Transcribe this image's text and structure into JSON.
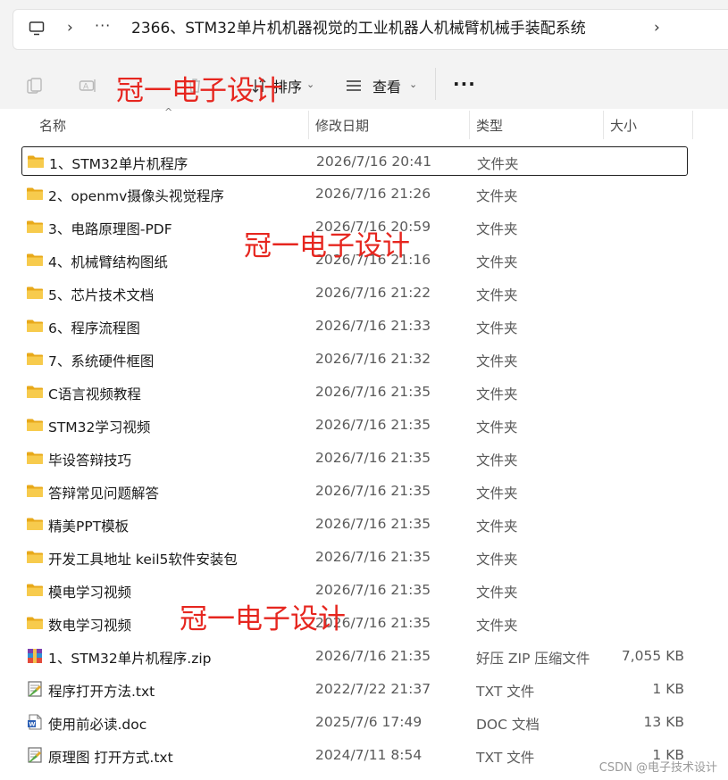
{
  "address": {
    "path": "2366、STM32单片机机器视觉的工业机器人机械臂机械手装配系统",
    "overflow": "···"
  },
  "commandbar": {
    "sort_label": "排序",
    "view_label": "查看",
    "more_label": "···"
  },
  "columns": {
    "name": "名称",
    "date": "修改日期",
    "type": "类型",
    "size": "大小"
  },
  "files": [
    {
      "name": "1、STM32单片机程序",
      "date": "2026/7/16 20:41",
      "type": "文件夹",
      "size": "",
      "icon": "folder-icon",
      "selected": true
    },
    {
      "name": "2、openmv摄像头视觉程序",
      "date": "2026/7/16 21:26",
      "type": "文件夹",
      "size": "",
      "icon": "folder-icon"
    },
    {
      "name": "3、电路原理图-PDF",
      "date": "2026/7/16 20:59",
      "type": "文件夹",
      "size": "",
      "icon": "folder-icon"
    },
    {
      "name": "4、机械臂结构图纸",
      "date": "2026/7/16 21:16",
      "type": "文件夹",
      "size": "",
      "icon": "folder-icon"
    },
    {
      "name": "5、芯片技术文档",
      "date": "2026/7/16 21:22",
      "type": "文件夹",
      "size": "",
      "icon": "folder-icon"
    },
    {
      "name": "6、程序流程图",
      "date": "2026/7/16 21:33",
      "type": "文件夹",
      "size": "",
      "icon": "folder-icon"
    },
    {
      "name": "7、系统硬件框图",
      "date": "2026/7/16 21:32",
      "type": "文件夹",
      "size": "",
      "icon": "folder-icon"
    },
    {
      "name": "C语言视频教程",
      "date": "2026/7/16 21:35",
      "type": "文件夹",
      "size": "",
      "icon": "folder-icon"
    },
    {
      "name": "STM32学习视频",
      "date": "2026/7/16 21:35",
      "type": "文件夹",
      "size": "",
      "icon": "folder-icon"
    },
    {
      "name": "毕设答辩技巧",
      "date": "2026/7/16 21:35",
      "type": "文件夹",
      "size": "",
      "icon": "folder-icon"
    },
    {
      "name": "答辩常见问题解答",
      "date": "2026/7/16 21:35",
      "type": "文件夹",
      "size": "",
      "icon": "folder-icon"
    },
    {
      "name": "精美PPT模板",
      "date": "2026/7/16 21:35",
      "type": "文件夹",
      "size": "",
      "icon": "folder-icon"
    },
    {
      "name": "开发工具地址 keil5软件安装包",
      "date": "2026/7/16 21:35",
      "type": "文件夹",
      "size": "",
      "icon": "folder-icon"
    },
    {
      "name": "模电学习视频",
      "date": "2026/7/16 21:35",
      "type": "文件夹",
      "size": "",
      "icon": "folder-icon"
    },
    {
      "name": "数电学习视频",
      "date": "2026/7/16 21:35",
      "type": "文件夹",
      "size": "",
      "icon": "folder-icon"
    },
    {
      "name": "1、STM32单片机程序.zip",
      "date": "2026/7/16 21:35",
      "type": "好压 ZIP 压缩文件",
      "size": "7,055 KB",
      "icon": "zip-archive-icon"
    },
    {
      "name": "程序打开方法.txt",
      "date": "2022/7/22 21:37",
      "type": "TXT 文件",
      "size": "1 KB",
      "icon": "text-file-icon"
    },
    {
      "name": "使用前必读.doc",
      "date": "2025/7/6 17:49",
      "type": "DOC 文档",
      "size": "13 KB",
      "icon": "word-doc-icon"
    },
    {
      "name": "原理图 打开方式.txt",
      "date": "2024/7/11 8:54",
      "type": "TXT 文件",
      "size": "1 KB",
      "icon": "text-file-icon"
    }
  ],
  "watermarks": [
    "冠一电子设计",
    "冠一电子设计",
    "冠一电子设计"
  ],
  "credit": "CSDN @电子技术设计",
  "colors": {
    "folder": "#f5c542",
    "watermark": "#e6261f",
    "selection_border": "#1f1f1f"
  }
}
